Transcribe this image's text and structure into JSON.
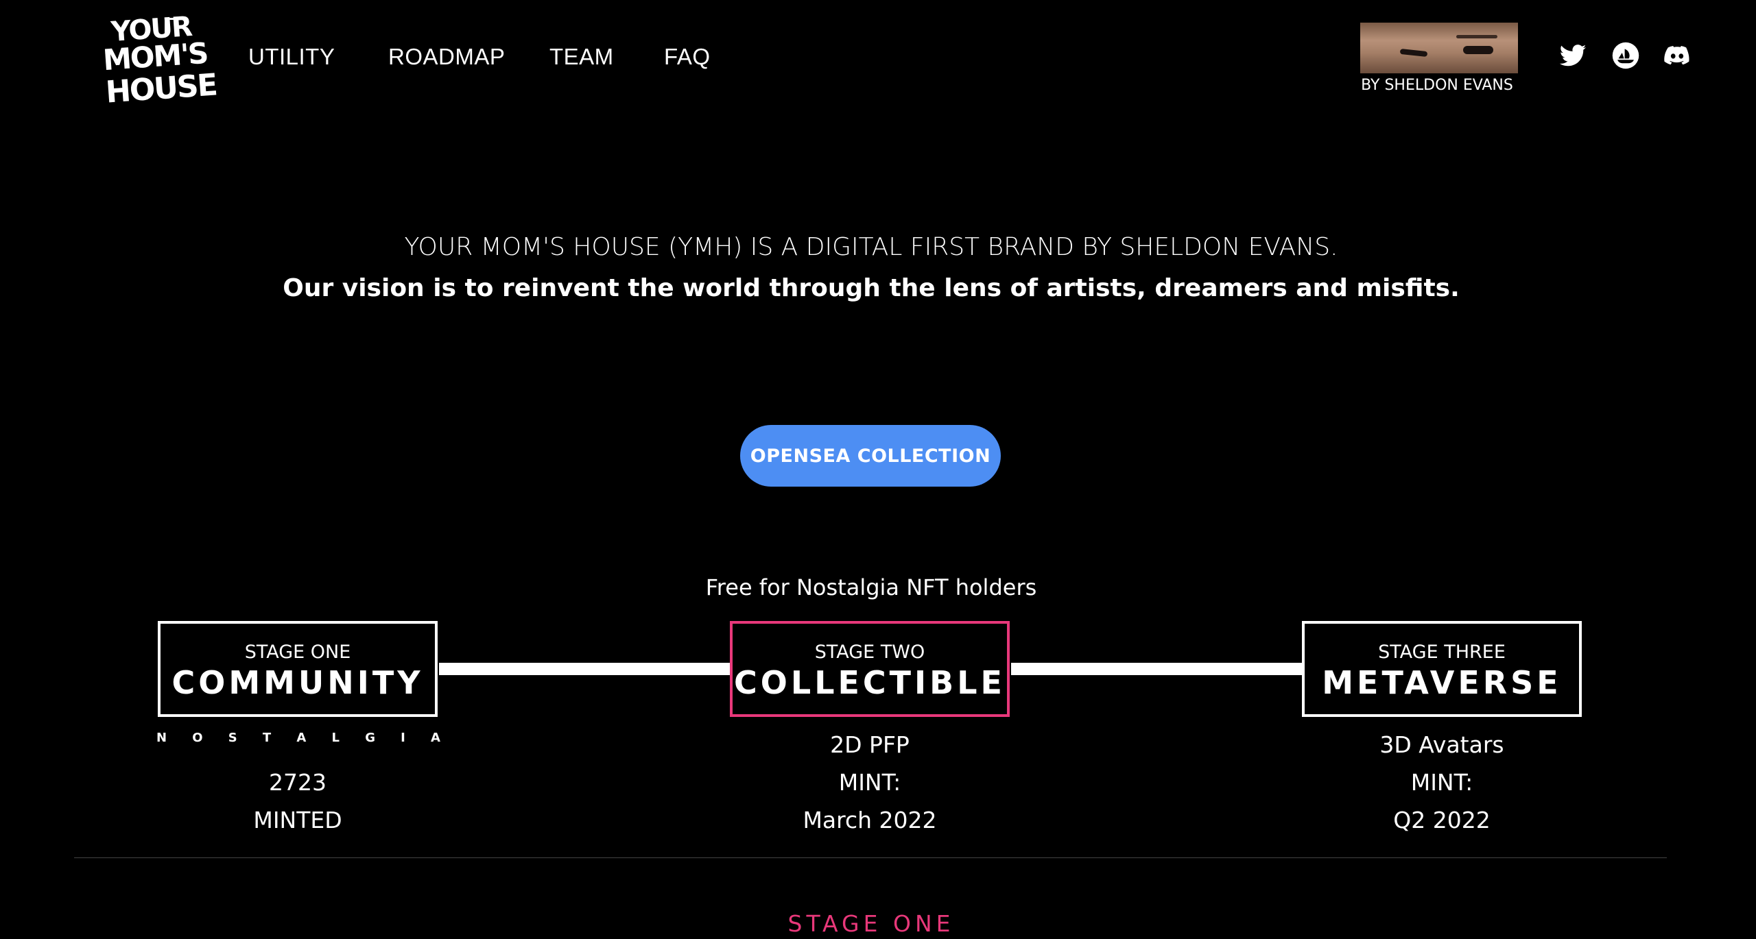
{
  "header": {
    "logo_lines": [
      "YOUR",
      "MOM'S",
      "HOUSE"
    ],
    "nav": [
      "UTILITY",
      "ROADMAP",
      "TEAM",
      "FAQ"
    ],
    "byline": "BY SHELDON EVANS",
    "social_icons": [
      "twitter-icon",
      "opensea-icon",
      "discord-icon"
    ]
  },
  "hero": {
    "tagline": "YOUR MOM'S HOUSE (YMH) IS A DIGITAL FIRST BRAND BY SHELDON EVANS.",
    "vision": "Our vision is to reinvent the world through the lens of artists, dreamers and misfits.",
    "cta_label": "OPENSEA COLLECTION",
    "cta_color": "#4d8ef3"
  },
  "roadmap": {
    "note": "Free for Nostalgia NFT holders",
    "stages": [
      {
        "sub": "STAGE ONE",
        "title": "COMMUNITY",
        "lines": [
          "2723",
          "MINTED"
        ],
        "badge_letters": [
          "N",
          "O",
          "S",
          "T",
          "A",
          "L",
          "G",
          "I",
          "A"
        ]
      },
      {
        "sub": "STAGE TWO",
        "title": "COLLECTIBLE",
        "lines": [
          "2D PFP",
          "MINT:",
          "March 2022"
        ],
        "active": true
      },
      {
        "sub": "STAGE THREE",
        "title": "METAVERSE",
        "lines": [
          "3D Avatars",
          "MINT:",
          "Q2 2022"
        ]
      }
    ],
    "accent_color": "#e8387a"
  },
  "section": {
    "label": "STAGE ONE"
  }
}
